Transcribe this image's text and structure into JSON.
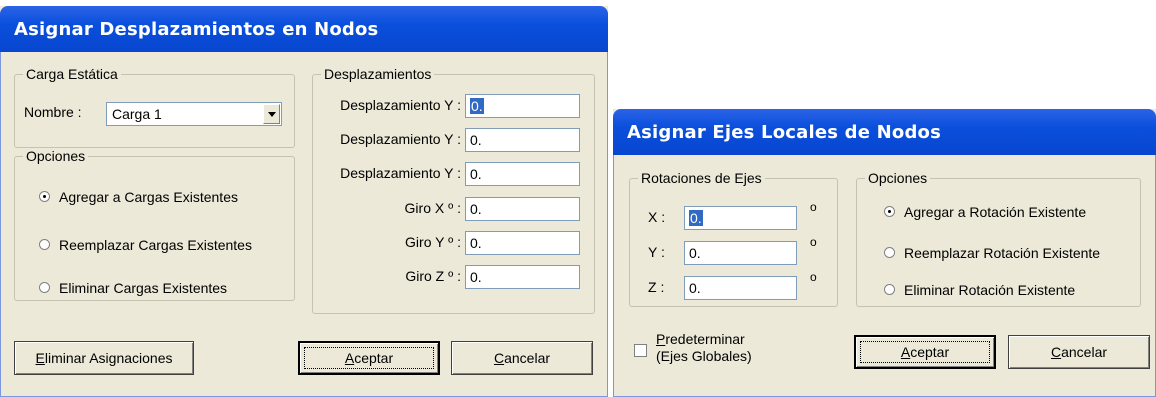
{
  "left_dialog": {
    "title": "Asignar Desplazamientos en Nodos",
    "carga_estatica": {
      "legend": "Carga Estática",
      "nombre_label": "Nombre :",
      "nombre_value": "Carga 1"
    },
    "opciones": {
      "legend": "Opciones",
      "options": [
        {
          "label": "Agregar a Cargas Existentes",
          "selected": true
        },
        {
          "label": "Reemplazar Cargas Existentes",
          "selected": false
        },
        {
          "label": "Eliminar Cargas Existentes",
          "selected": false
        }
      ]
    },
    "desplazamientos": {
      "legend": "Desplazamientos",
      "fields": [
        {
          "label": "Desplazamiento Y :",
          "value": "0."
        },
        {
          "label": "Desplazamiento Y :",
          "value": "0."
        },
        {
          "label": "Desplazamiento Y :",
          "value": "0."
        },
        {
          "label": "Giro X º :",
          "value": "0."
        },
        {
          "label": "Giro Y º :",
          "value": "0."
        },
        {
          "label": "Giro Z º :",
          "value": "0."
        }
      ]
    },
    "buttons": {
      "eliminar_first": "E",
      "eliminar_rest": "liminar Asignaciones",
      "aceptar_first": "A",
      "aceptar_rest": "ceptar",
      "cancelar_first": "C",
      "cancelar_rest": "ancelar"
    }
  },
  "right_dialog": {
    "title": "Asignar Ejes Locales de Nodos",
    "rotaciones": {
      "legend": "Rotaciones de Ejes",
      "fields": [
        {
          "label": "X :",
          "value": "0.",
          "unit": "o"
        },
        {
          "label": "Y :",
          "value": "0.",
          "unit": "o"
        },
        {
          "label": "Z :",
          "value": "0.",
          "unit": "o"
        }
      ]
    },
    "opciones": {
      "legend": "Opciones",
      "options": [
        {
          "label": "Agregar a Rotación Existente",
          "selected": true
        },
        {
          "label": "Reemplazar Rotación Existente",
          "selected": false
        },
        {
          "label": "Eliminar Rotación Existente",
          "selected": false
        }
      ]
    },
    "predeterminar": {
      "line1_first": "P",
      "line1_rest": "redeterminar",
      "line2": "(Ejes Globales)",
      "checked": false
    },
    "buttons": {
      "aceptar_first": "A",
      "aceptar_rest": "ceptar",
      "cancelar_first": "C",
      "cancelar_rest": "ancelar"
    }
  }
}
